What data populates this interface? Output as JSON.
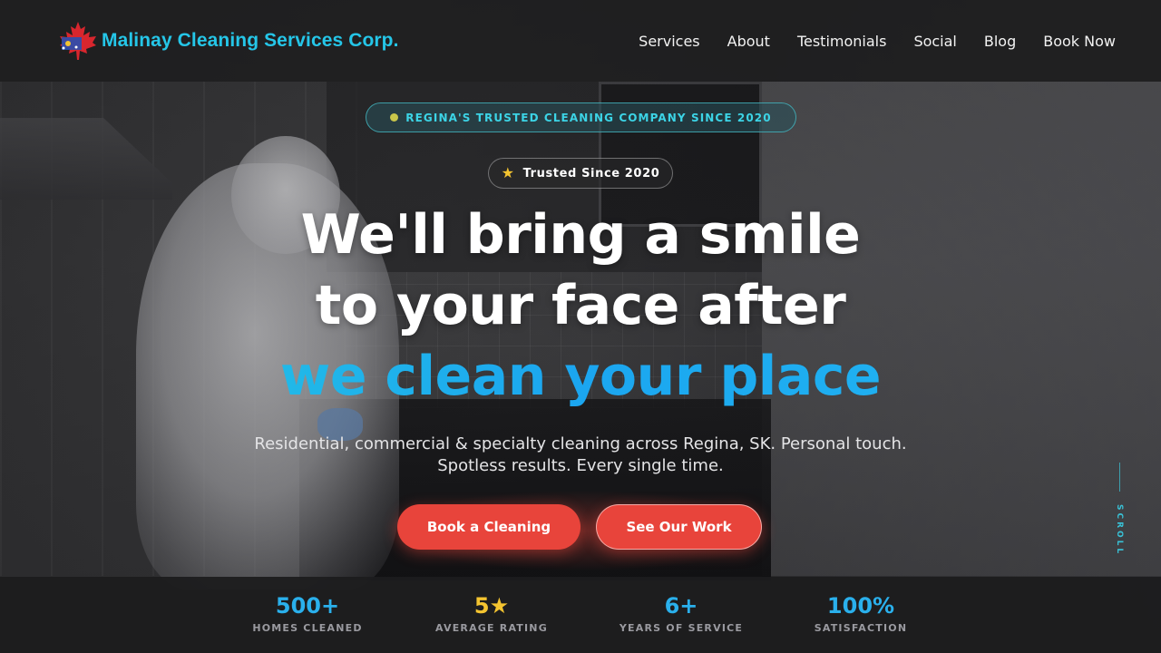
{
  "header": {
    "brand_name": "Malinay Cleaning Services Corp.",
    "logo_icon": "maple-leaf-logo-icon",
    "nav": [
      "Services",
      "About",
      "Testimonials",
      "Social",
      "Blog",
      "Book Now"
    ]
  },
  "hero": {
    "badge_top": "REGINA'S TRUSTED CLEANING COMPANY SINCE 2020",
    "badge_trusted": "Trusted Since 2020",
    "headline_line1": "We'll bring a smile",
    "headline_line2": "to your face after",
    "headline_accent": "we clean your place",
    "subtext_line1": "Residential, commercial & specialty cleaning across Regina, SK. Personal touch.",
    "subtext_line2": "Spotless results. Every single time.",
    "cta_primary": "Book a Cleaning",
    "cta_secondary": "See Our Work",
    "scroll_label": "SCROLL"
  },
  "stats": [
    {
      "value": "500+",
      "label": "HOMES CLEANED"
    },
    {
      "value": "5★",
      "label": "AVERAGE RATING"
    },
    {
      "value": "6+",
      "label": "YEARS OF SERVICE"
    },
    {
      "value": "100%",
      "label": "SATISFACTION"
    }
  ],
  "colors": {
    "brand_cyan": "#25c6e8",
    "accent_blue": "#1ba6f0",
    "cta_red": "#e8443b",
    "star_gold": "#f4c430"
  }
}
